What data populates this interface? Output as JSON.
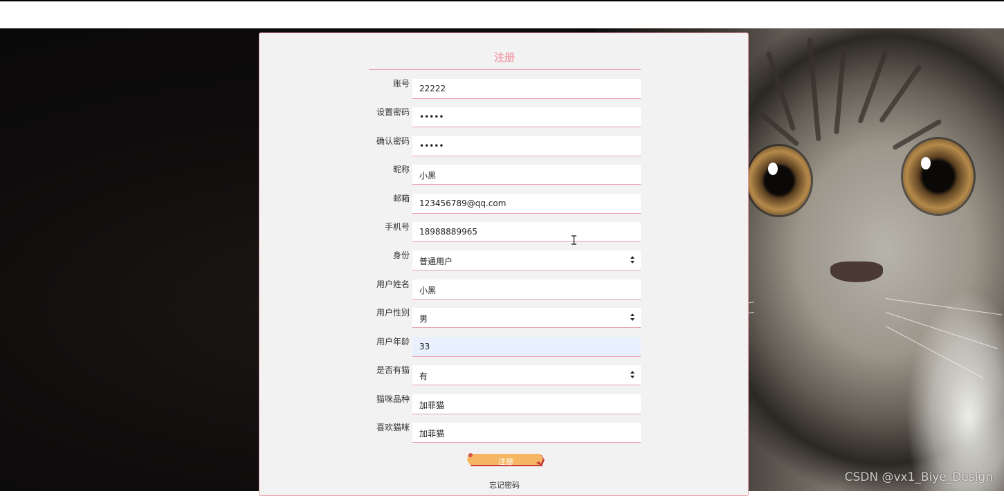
{
  "form": {
    "title": "注册",
    "fields": [
      {
        "label": "账号",
        "value": "22222",
        "type": "text"
      },
      {
        "label": "设置密码",
        "value": "•••••",
        "type": "password"
      },
      {
        "label": "确认密码",
        "value": "•••••",
        "type": "password"
      },
      {
        "label": "昵称",
        "value": "小黑",
        "type": "text"
      },
      {
        "label": "邮箱",
        "value": "123456789@qq.com",
        "type": "text"
      },
      {
        "label": "手机号",
        "value": "18988889965",
        "type": "text"
      },
      {
        "label": "身份",
        "value": "普通用户",
        "type": "select"
      },
      {
        "label": "用户姓名",
        "value": "小黑",
        "type": "text"
      },
      {
        "label": "用户性别",
        "value": "男",
        "type": "select"
      },
      {
        "label": "用户年龄",
        "value": "33",
        "type": "text",
        "focused": true
      },
      {
        "label": "是否有猫",
        "value": "有",
        "type": "select"
      },
      {
        "label": "猫咪品种",
        "value": "加菲猫",
        "type": "text"
      },
      {
        "label": "喜欢猫咪",
        "value": "加菲猫",
        "type": "text"
      }
    ],
    "submit_label": "注册",
    "forgot_password": "忘记密码"
  },
  "watermark": "CSDN @vx1_Biye_Design",
  "colors": {
    "accent_pink": "#f2a5b1",
    "field_border": "#e7a0ab",
    "button_orange": "#f5b764",
    "button_red": "#c83a3a",
    "focused_field_bg": "#e8f0fe"
  },
  "icons": {
    "select_arrow": "up-down-arrows-icon",
    "cursor": "text-cursor-icon"
  }
}
